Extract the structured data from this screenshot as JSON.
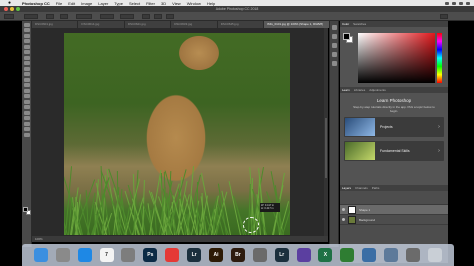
{
  "menubar": {
    "app_name": "Photoshop CC",
    "items": [
      "File",
      "Edit",
      "Image",
      "Layer",
      "Type",
      "Select",
      "Filter",
      "3D",
      "View",
      "Window",
      "Help"
    ]
  },
  "window": {
    "title": "Adobe Photoshop CC 2018"
  },
  "tabs": [
    {
      "label": "DSC0601.jpg"
    },
    {
      "label": "DSC0614.jpg"
    },
    {
      "label": "DSC0621.jpg"
    },
    {
      "label": "DSC0633.jpg"
    },
    {
      "label": "DSC0645.jpg"
    },
    {
      "label": "IMG_0101.jpg @ 100% (Shape 1, RGB/8)",
      "active": true
    }
  ],
  "canvas": {
    "coords_readout": [
      "W: 0.417 in",
      "H: 0.417 in"
    ]
  },
  "status": {
    "zoom": "100%"
  },
  "color_panel": {
    "tabs": [
      "Color",
      "Swatches"
    ]
  },
  "learn_panel": {
    "tabs": [
      "Learn",
      "Libraries",
      "Adjustments"
    ],
    "title": "Learn Photoshop",
    "description": "Step-by-step tutorials directly in the app. Pick a topic below to begin.",
    "cards": [
      {
        "label": "Projects"
      },
      {
        "label": "Fundamental Skills"
      }
    ]
  },
  "layers_panel": {
    "tabs": [
      "Layers",
      "Channels",
      "Paths"
    ],
    "layers": [
      {
        "name": "Shape 1",
        "selected": true
      },
      {
        "name": "Background",
        "selected": false
      }
    ]
  },
  "dock": {
    "apps": [
      {
        "name": "finder-icon",
        "glyph": "",
        "color": "#3b8fe0"
      },
      {
        "name": "launchpad-icon",
        "glyph": "",
        "color": "#8a8a8a"
      },
      {
        "name": "safari-icon",
        "glyph": "",
        "color": "#1e88e5"
      },
      {
        "name": "calendar-icon",
        "glyph": "7",
        "color": "#f4f4f4"
      },
      {
        "name": "settings-icon",
        "glyph": "",
        "color": "#7d7d7d"
      },
      {
        "name": "photoshop-icon",
        "glyph": "Ps",
        "color": "#0b2a45"
      },
      {
        "name": "chrome-icon",
        "glyph": "",
        "color": "#e53935"
      },
      {
        "name": "lightroom-icon",
        "glyph": "Lr",
        "color": "#1b2f3d"
      },
      {
        "name": "illustrator-icon",
        "glyph": "Ai",
        "color": "#2c1a05"
      },
      {
        "name": "bridge-icon",
        "glyph": "Br",
        "color": "#2d1b0e"
      },
      {
        "name": "acrobat-icon",
        "glyph": "",
        "color": "#6a6a6a"
      },
      {
        "name": "lightroom-classic-icon",
        "glyph": "Lr",
        "color": "#1b2f3d"
      },
      {
        "name": "imovie-icon",
        "glyph": "",
        "color": "#5b3fa0"
      },
      {
        "name": "excel-icon",
        "glyph": "X",
        "color": "#1e7145"
      },
      {
        "name": "facetime-icon",
        "glyph": "",
        "color": "#2e7d32"
      },
      {
        "name": "quicktime-icon",
        "glyph": "",
        "color": "#3a6ea5"
      },
      {
        "name": "preview-icon",
        "glyph": "",
        "color": "#5d7a9a"
      },
      {
        "name": "photos-icon",
        "glyph": "",
        "color": "#6b6b6b"
      },
      {
        "name": "trash-icon",
        "glyph": "",
        "color": "#c9cfd6"
      }
    ]
  }
}
